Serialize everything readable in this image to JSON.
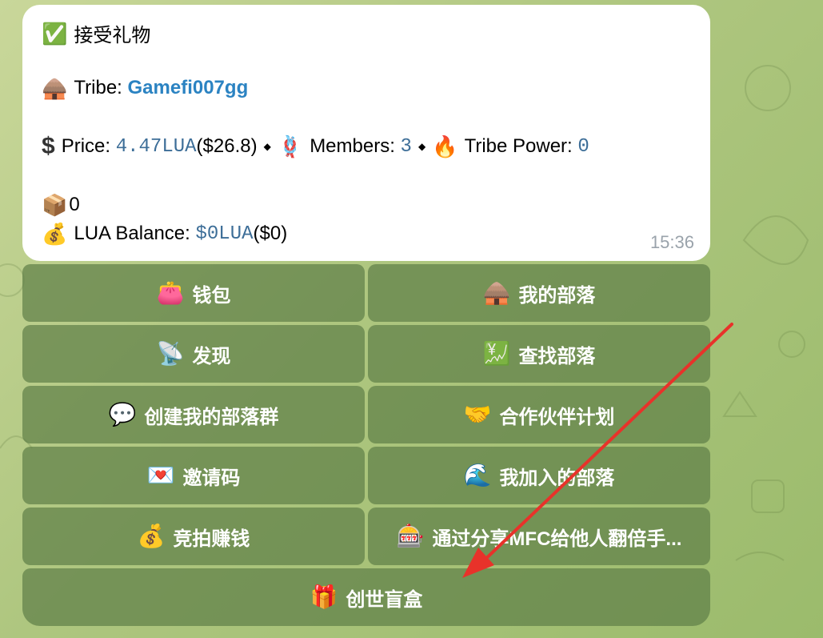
{
  "message": {
    "title": "接受礼物",
    "title_icon": "check-mark-icon",
    "tribe_label": "Tribe: ",
    "tribe_icon": "hut-icon",
    "tribe_name": "Gamefi007gg",
    "price_icon": "dollar-icon",
    "price_label": "Price: ",
    "price_value": "4.47LUA",
    "price_usd": "($26.8)",
    "members_icon": "knot-icon",
    "members_label": "Members: ",
    "members_value": "3",
    "power_icon": "fire-icon",
    "power_label": "Tribe Power: ",
    "power_value": "0",
    "box_icon": "package-icon",
    "box_value": "0",
    "balance_icon": "money-bag-icon",
    "balance_label": "LUA Balance: ",
    "balance_value": "$0LUA",
    "balance_usd": "($0)",
    "time": "15:36"
  },
  "keyboard": {
    "rows": [
      [
        {
          "label": "钱包",
          "icon": "purse-icon"
        },
        {
          "label": "我的部落",
          "icon": "hut-icon"
        }
      ],
      [
        {
          "label": "发现",
          "icon": "satellite-dish-icon"
        },
        {
          "label": "查找部落",
          "icon": "chart-yen-icon"
        }
      ],
      [
        {
          "label": "创建我的部落群",
          "icon": "speech-bubble-icon"
        },
        {
          "label": "合作伙伴计划",
          "icon": "handshake-icon"
        }
      ],
      [
        {
          "label": "邀请码",
          "icon": "love-letter-icon"
        },
        {
          "label": "我加入的部落",
          "icon": "wave-icon"
        }
      ],
      [
        {
          "label": "竞拍赚钱",
          "icon": "money-bag-icon"
        },
        {
          "label": "通过分享MFC给他人翻倍手...",
          "icon": "slot-machine-icon"
        }
      ],
      [
        {
          "label": "创世盲盒",
          "icon": "gift-icon"
        }
      ]
    ]
  },
  "colors": {
    "accent_link": "#2b83c2",
    "mono_value": "#3d6e98",
    "arrow": "#e8322a",
    "button_bg": "rgba(96,128,72,0.72)"
  }
}
